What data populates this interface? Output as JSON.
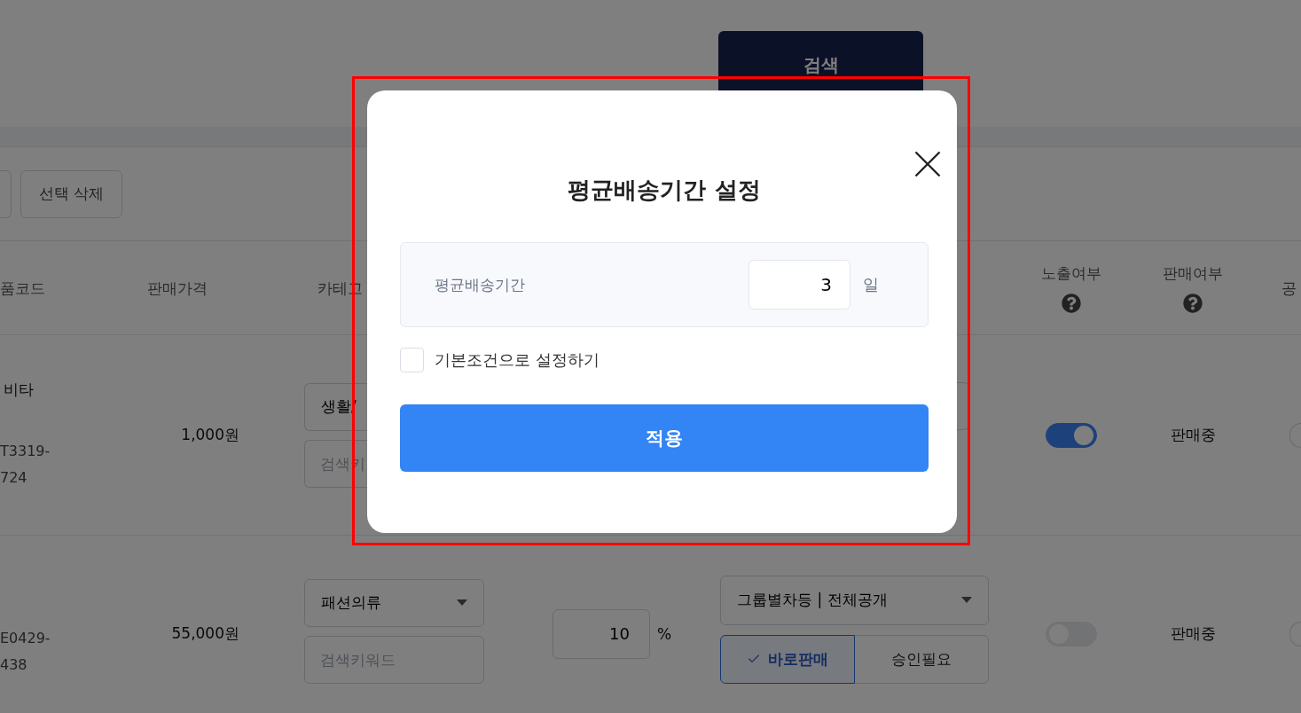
{
  "search": {
    "button": "검색"
  },
  "toolbar": {
    "buttons": [
      "선택 삭제"
    ]
  },
  "table": {
    "columns": [
      {
        "label": "품코드",
        "help": false
      },
      {
        "label": "판매가격",
        "help": false
      },
      {
        "label": "카테고",
        "help": false
      },
      {
        "label": "노출여부",
        "help": true
      },
      {
        "label": "판매여부",
        "help": true
      },
      {
        "label": "공",
        "help": false
      }
    ],
    "rows": [
      {
        "name": "비타",
        "code_lines": [
          "T3319-",
          "724"
        ],
        "price": "1,000원",
        "category": {
          "kind": "cut",
          "value": "생활/",
          "keyword_placeholder": "검색키"
        },
        "exposure": {
          "kind": "cut"
        },
        "on": true,
        "status": "판매중",
        "column_8": {
          "on": false
        }
      },
      {
        "code_lines": [
          "E0429-",
          "438"
        ],
        "price": "55,000원",
        "category": {
          "kind": "full",
          "value": "패션의류",
          "keyword_placeholder": "검색키워드"
        },
        "margin": {
          "value": "10",
          "unit": "%"
        },
        "exposure": {
          "kind": "full",
          "value": "그룹별차등 | 전체공개",
          "modes": [
            {
              "label": "바로판매",
              "selected": true
            },
            {
              "label": "승인필요",
              "selected": false
            }
          ]
        },
        "on": false,
        "status": "판매중",
        "column_8": {
          "on": false
        }
      }
    ]
  },
  "dialog": {
    "title": "평균배송기간 설정",
    "field": {
      "label": "평균배송기간",
      "value": "3",
      "unit": "일"
    },
    "default_checkbox": {
      "label": "기본조건으로 설정하기",
      "checked": false
    },
    "apply_button": "적용"
  }
}
